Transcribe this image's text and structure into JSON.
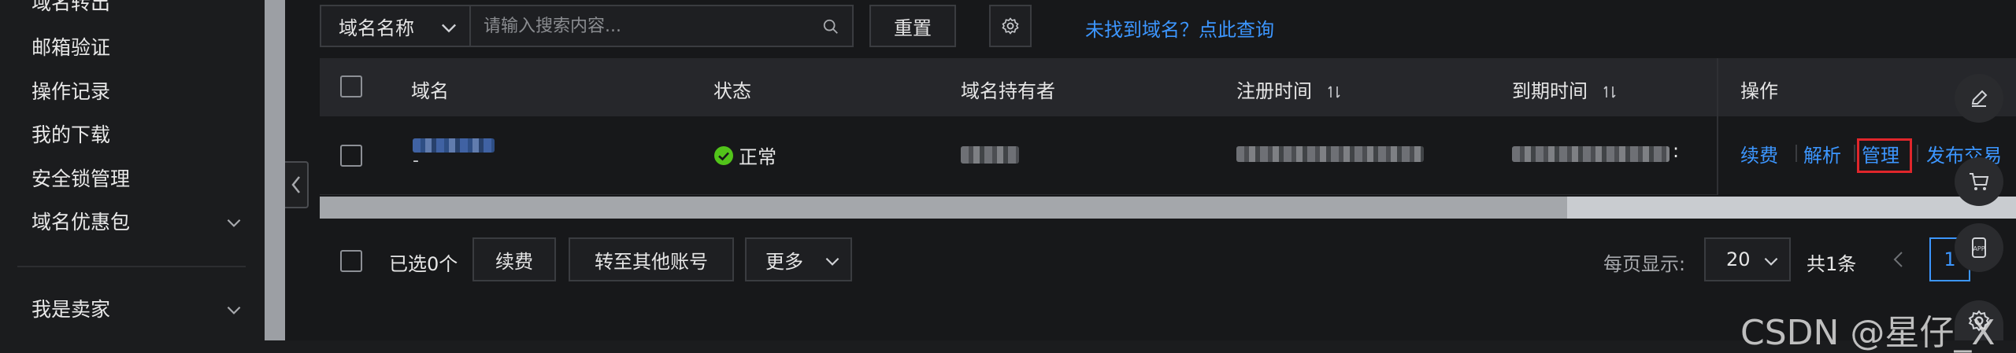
{
  "sidebar": {
    "items": [
      {
        "label": "域名转出"
      },
      {
        "label": "邮箱验证"
      },
      {
        "label": "操作记录"
      },
      {
        "label": "我的下载"
      },
      {
        "label": "安全锁管理"
      },
      {
        "label": "域名优惠包"
      },
      {
        "label": "我是卖家"
      }
    ]
  },
  "toolbar": {
    "filter_select_value": "域名名称",
    "search_placeholder": "请输入搜索内容...",
    "reset_label": "重置",
    "not_found_link": "未找到域名？点此查询"
  },
  "table": {
    "headers": {
      "domain": "域名",
      "status": "状态",
      "holder": "域名持有者",
      "reg_time": "注册时间",
      "expire_time": "到期时间",
      "actions": "操作"
    },
    "rows": [
      {
        "domain_sub": "-",
        "status": "正常",
        "expire_tail": ":",
        "actions": {
          "renew": "续费",
          "resolve": "解析",
          "manage": "管理",
          "publish": "发布交易"
        }
      }
    ]
  },
  "footer": {
    "selected_text": "已选0个",
    "renew_label": "续费",
    "transfer_label": "转至其他账号",
    "more_label": "更多",
    "page_size_label": "每页显示:",
    "page_size_value": "20",
    "total_text": "共1条",
    "current_page": "1"
  },
  "floating_tools": [
    {
      "icon": "edit-icon"
    },
    {
      "icon": "cart-icon"
    },
    {
      "icon": "app-icon"
    },
    {
      "icon": "settings-icon"
    }
  ],
  "watermark": "CSDN @星仔_X",
  "colors": {
    "link": "#3c96ff",
    "highlight": "#e0262b",
    "status_ok": "#52c41a"
  }
}
